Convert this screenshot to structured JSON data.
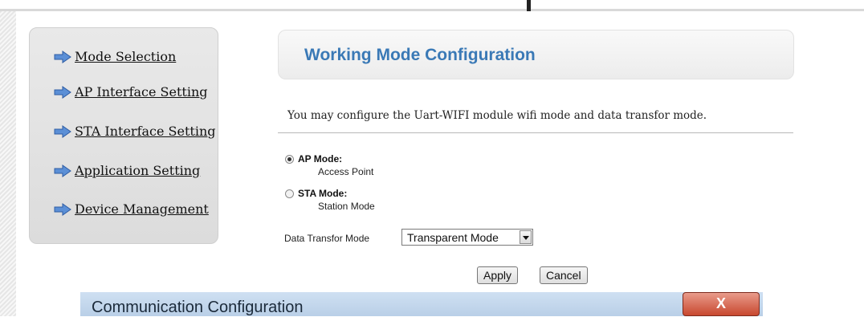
{
  "sidebar": {
    "items": [
      {
        "label": "Mode Selection",
        "icon": "arrow-right-icon"
      },
      {
        "label": "AP Interface Setting",
        "icon": "arrow-right-icon"
      },
      {
        "label": "STA Interface Setting",
        "icon": "arrow-right-icon"
      },
      {
        "label": "Application Setting",
        "icon": "arrow-right-icon"
      },
      {
        "label": "Device Management",
        "icon": "arrow-right-icon"
      }
    ]
  },
  "main": {
    "title": "Working Mode Configuration",
    "description": "You may configure the Uart-WIFI module wifi mode and data transfor mode.",
    "modes": [
      {
        "label": "AP Mode:",
        "sublabel": "Access Point",
        "checked": true
      },
      {
        "label": "STA Mode:",
        "sublabel": "Station Mode",
        "checked": false
      }
    ],
    "data_transfor_label": "Data Transfor Mode",
    "data_transfor_value": "Transparent Mode",
    "apply_label": "Apply",
    "cancel_label": "Cancel"
  },
  "dialog": {
    "title": "Communication Configuration",
    "close_label": "X"
  },
  "colors": {
    "title": "#3a79b6",
    "arrow": "#5b8fd6",
    "close": "#c8472f"
  }
}
